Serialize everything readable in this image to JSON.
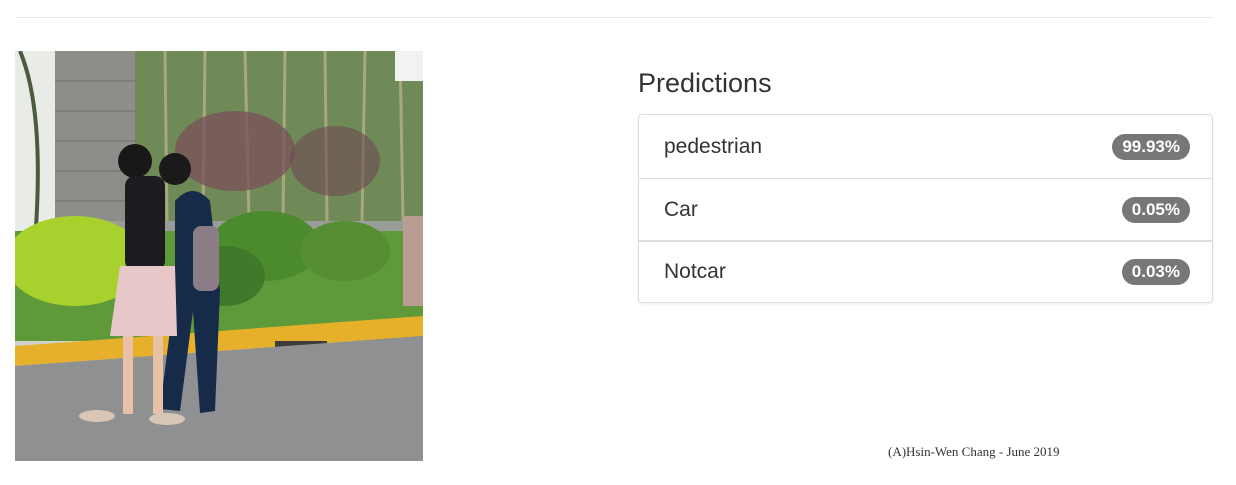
{
  "input_image": {
    "icon": "photo-two-pedestrians-walking"
  },
  "predictions": {
    "title": "Predictions",
    "items": [
      {
        "label": "pedestrian",
        "confidence": "99.93%"
      },
      {
        "label": "Car",
        "confidence": "0.05%"
      },
      {
        "label": "Notcar",
        "confidence": "0.03%"
      }
    ]
  },
  "footer": {
    "credit": "(A)Hsin-Wen Chang - June 2019"
  },
  "colors": {
    "badge": "#777777",
    "border": "#dddddd",
    "text": "#333333"
  }
}
